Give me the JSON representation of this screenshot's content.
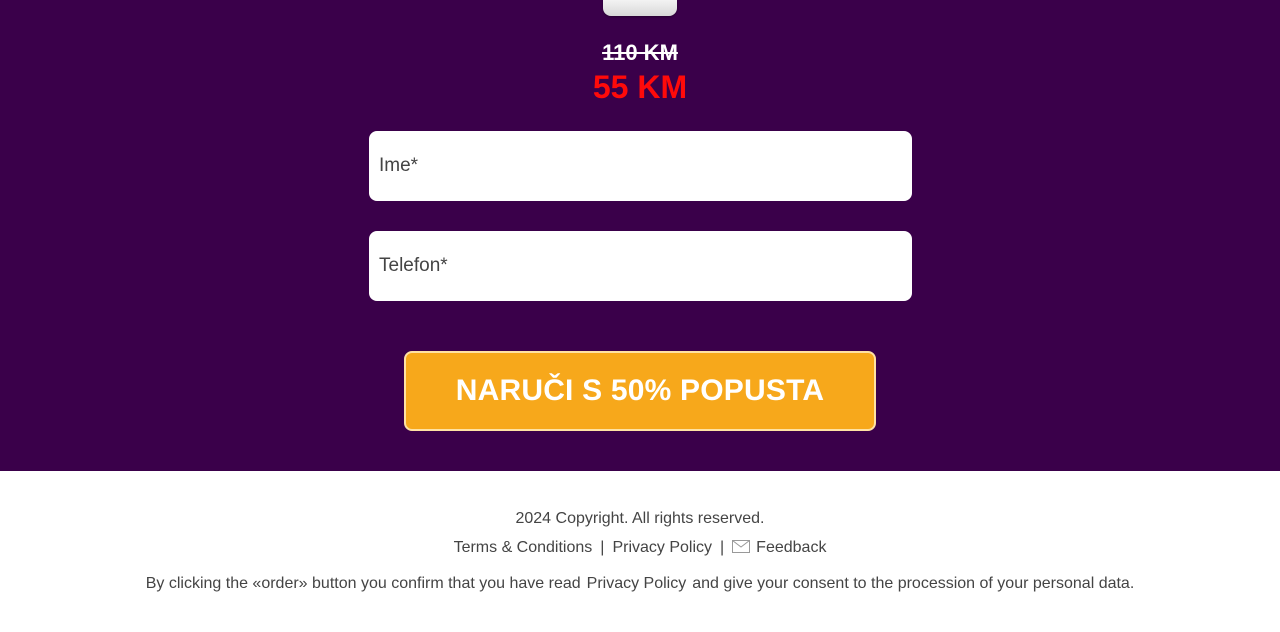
{
  "offer": {
    "old_price": "110 KM",
    "new_price": "55 KM"
  },
  "form": {
    "name_placeholder": "Ime*",
    "phone_placeholder": "Telefon*",
    "submit_label": "NARUČI S 50% POPUSTA"
  },
  "footer": {
    "copyright": "2024 Copyright. All rights reserved.",
    "terms_label": "Terms & Conditions",
    "privacy_label": "Privacy Policy",
    "feedback_label": "Feedback",
    "separator": "|",
    "consent_before": "By clicking the «order» button you confirm that you have read",
    "consent_link": "Privacy Policy",
    "consent_after": "and give your consent to the procession of your personal data."
  },
  "icons": {
    "feedback": "mail-icon"
  },
  "colors": {
    "hero_background": "#3a004a",
    "new_price": "#ff0a0a",
    "button": "#f7a81b",
    "footer_text": "#444444"
  }
}
